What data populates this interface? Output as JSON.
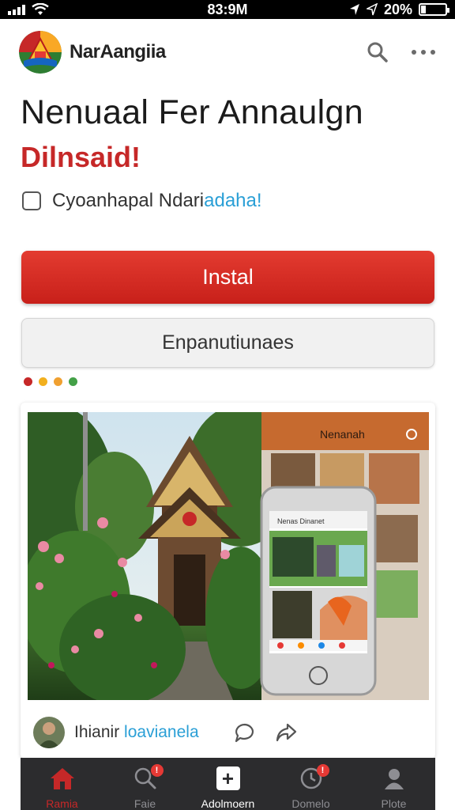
{
  "status_bar": {
    "time": "83:9M",
    "battery": "20%",
    "battery_level": 0.2
  },
  "header": {
    "app_name": "NarAangiia",
    "search_icon": "search-icon",
    "more_icon": "more-icon"
  },
  "hero": {
    "title": "Nenuaal Fer Annaulgn",
    "subtitle": "Dilnsaid!",
    "checkbox_text": "Cyoanhapal Ndari",
    "checkbox_link": "adaha!"
  },
  "buttons": {
    "install_label": "Instal",
    "secondary_label": "Enpanutiunaes"
  },
  "pager_dots": [
    "#c62828",
    "#f2b01e",
    "#f0a030",
    "#43a047"
  ],
  "card": {
    "phone_header": "Nenanah",
    "phone_inner_title": "Nenas Dinanet",
    "author_name": "Ihianir",
    "author_link": "loavianela",
    "actions": [
      "comment-icon",
      "share-icon"
    ]
  },
  "nav": {
    "items": [
      {
        "label": "Ramia",
        "icon": "home-icon"
      },
      {
        "label": "Faie",
        "icon": "search-icon",
        "badge": "!"
      },
      {
        "label": "Adolmoern",
        "icon": "plus-icon"
      },
      {
        "label": "Domelo",
        "icon": "clock-icon",
        "badge": "!"
      },
      {
        "label": "Plote",
        "icon": "profile-icon"
      }
    ]
  },
  "colors": {
    "accent": "#c62828",
    "link": "#2a9fd6",
    "nav_bg": "#2c2c2e"
  }
}
